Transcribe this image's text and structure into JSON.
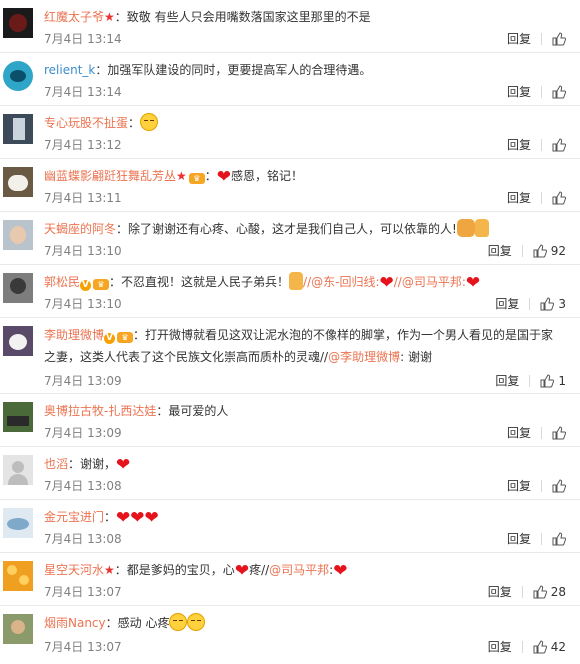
{
  "comments": [
    {
      "user": "红魔太子爷",
      "sep": "：",
      "body": "致敬   有些人只会用嘴数落国家这里那里的不是",
      "time": "7月4日 13:14",
      "reply": "回复",
      "likes": ""
    },
    {
      "user": "relient_k",
      "sep": "：",
      "body": "加强军队建设的同时，更要提高军人的合理待遇。",
      "time": "7月4日 13:14",
      "reply": "回复",
      "likes": ""
    },
    {
      "user": "专心玩股不扯蛋",
      "sep": "：",
      "body": "",
      "time": "7月4日 13:12",
      "reply": "回复",
      "likes": ""
    },
    {
      "user": "幽蓝蝶影翩跹狂舞乱芳丛",
      "sep": "：",
      "body": "感恩，铭记！",
      "time": "7月4日 13:11",
      "reply": "回复",
      "likes": ""
    },
    {
      "user": "天蝎座的阿冬",
      "sep": "：",
      "body": "除了谢谢还有心疼、心酸，这才是我们自己人，可以依靠的人!",
      "time": "7月4日 13:10",
      "reply": "回复",
      "likes": "92"
    },
    {
      "user": "郭松民",
      "sep": "：",
      "body": "不忍直视！这就是人民子弟兵！",
      "mention1": "//@东-回归线:",
      "mention2": "//@司马平邦:",
      "time": "7月4日 13:10",
      "reply": "回复",
      "likes": "3"
    },
    {
      "user": "李助理微博",
      "sep": "：",
      "body": "打开微博就看见这双让泥水泡的不像样的脚掌，作为一个男人看见的是国于家之妻，这类人代表了这个民族文化崇高而质朴的灵魂//",
      "mention1": "@李助理微博",
      "body2": ": 谢谢",
      "time": "7月4日 13:09",
      "reply": "回复",
      "likes": "1"
    },
    {
      "user": "奥博拉古牧-扎西达娃",
      "sep": "：",
      "body": "最可爱的人",
      "time": "7月4日 13:09",
      "reply": "回复",
      "likes": ""
    },
    {
      "user": "也滔",
      "sep": "：",
      "body": "谢谢，",
      "time": "7月4日 13:08",
      "reply": "回复",
      "likes": ""
    },
    {
      "user": "金元宝进门",
      "sep": "：",
      "body": "",
      "time": "7月4日 13:08",
      "reply": "回复",
      "likes": ""
    },
    {
      "user": "星空天河水",
      "sep": "：",
      "body": "都是爹妈的宝贝，心",
      "body2": "疼//",
      "mention1": "@司马平邦",
      "body3": ":",
      "time": "7月4日 13:07",
      "reply": "回复",
      "likes": "28"
    },
    {
      "user": "烟雨Nancy",
      "sep": "：",
      "body": "感动  心疼",
      "time": "7月4日 13:07",
      "reply": "回复",
      "likes": "42"
    }
  ],
  "colors": {
    "username": "#eb7350",
    "text": "#333333",
    "time": "#808080",
    "heart": "#e5141c"
  },
  "icons": {
    "like": "thumbs-up-icon",
    "member": "star-icon",
    "verified": "v-badge-icon",
    "heart": "heart-emoji-icon"
  }
}
